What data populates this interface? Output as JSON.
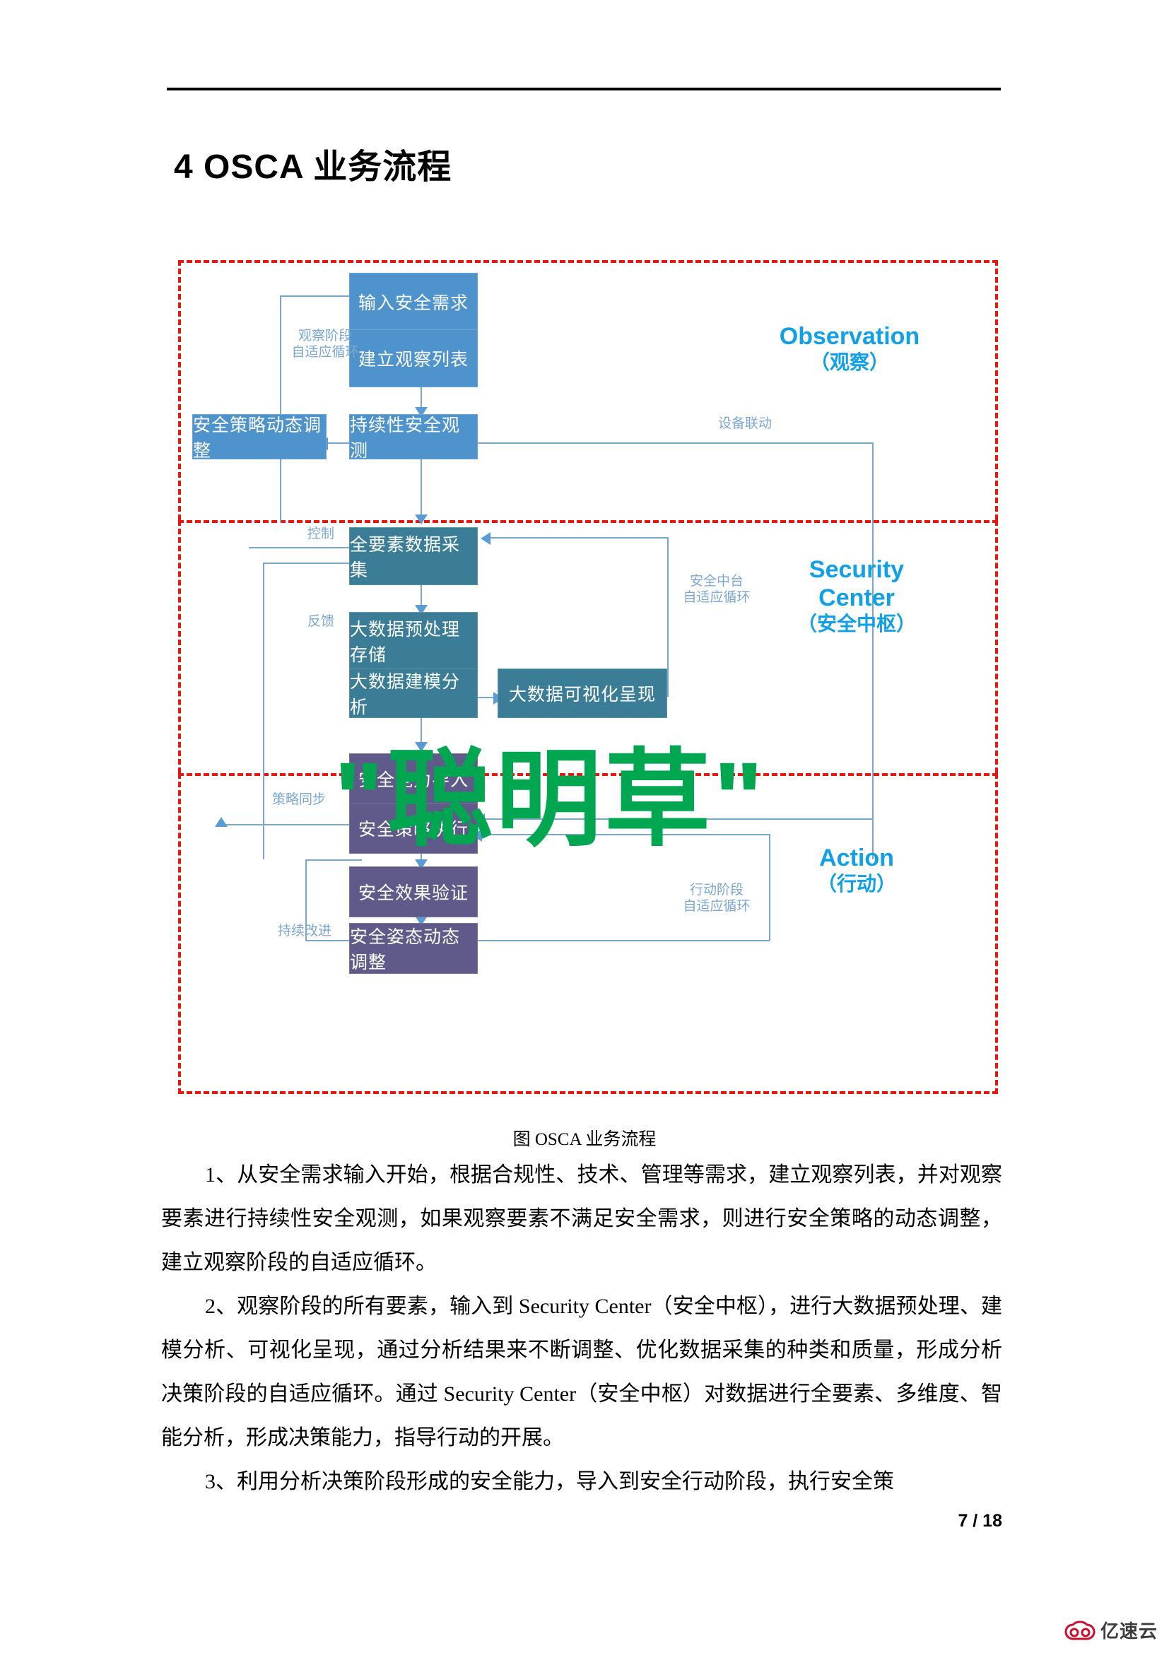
{
  "document": {
    "title": "4 OSCA 业务流程",
    "page_number": "7 / 18",
    "figure_caption": "图  OSCA 业务流程"
  },
  "figure": {
    "watermark": "\"聪明草\"",
    "zones": [
      {
        "id": "observation",
        "en": "Observation",
        "cn": "（观察）",
        "color": "#11a0e8"
      },
      {
        "id": "security-center",
        "en": "Security Center",
        "cn": "（安全中枢）",
        "color": "#11a0e8"
      },
      {
        "id": "action",
        "en": "Action",
        "cn": "（行动）",
        "color": "#11a0e8"
      }
    ],
    "zone_labels": {
      "observation_en": "Observation",
      "observation_cn": "（观察）",
      "security_en_line1": "Security",
      "security_en_line2": "Center",
      "security_cn": "（安全中枢）",
      "action_en": "Action",
      "action_cn": "（行动）"
    },
    "boxes": [
      {
        "id": "input-security-requirement",
        "label": "输入安全需求",
        "zone": "observation",
        "fill": "#4f93cd"
      },
      {
        "id": "build-observation-list",
        "label": "建立观察列表",
        "zone": "observation",
        "fill": "#4f93cd"
      },
      {
        "id": "continuous-security-observation",
        "label": "持续性安全观测",
        "zone": "observation",
        "fill": "#4f93cd"
      },
      {
        "id": "security-policy-dynamic-adjustment",
        "label": "安全策略动态调整",
        "zone": "observation",
        "fill": "#4f93cd"
      },
      {
        "id": "all-element-data-collection",
        "label": "全要素数据采集",
        "zone": "security-center",
        "fill": "#3b7d96"
      },
      {
        "id": "bigdata-preprocess-storage",
        "label": "大数据预处理存储",
        "zone": "security-center",
        "fill": "#3b7d96"
      },
      {
        "id": "bigdata-modeling-analysis",
        "label": "大数据建模分析",
        "zone": "security-center",
        "fill": "#3b7d96"
      },
      {
        "id": "bigdata-visualization",
        "label": "大数据可视化呈现",
        "zone": "security-center",
        "fill": "#3b7d96"
      },
      {
        "id": "security-capability-import",
        "label": "安全能力导入",
        "zone": "action",
        "fill": "#605a8a"
      },
      {
        "id": "security-policy-execution",
        "label": "安全策略执行",
        "zone": "action",
        "fill": "#605a8a"
      },
      {
        "id": "security-effect-validation",
        "label": "安全效果验证",
        "zone": "action",
        "fill": "#605a8a"
      },
      {
        "id": "security-posture-dynamic-adjustment",
        "label": "安全姿态动态调整",
        "zone": "action",
        "fill": "#605a8a"
      }
    ],
    "annotations": [
      {
        "id": "observation-adaptive-loop",
        "line1": "观察阶段",
        "line2": "自适应循环"
      },
      {
        "id": "device-linkage",
        "line1": "设备联动",
        "line2": ""
      },
      {
        "id": "control",
        "line1": "控制",
        "line2": ""
      },
      {
        "id": "feedback",
        "line1": "反馈",
        "line2": ""
      },
      {
        "id": "security-midplatform-adaptive-loop",
        "line1": "安全中台",
        "line2": "自适应循环"
      },
      {
        "id": "policy-sync",
        "line1": "策略同步",
        "line2": ""
      },
      {
        "id": "action-adaptive-loop",
        "line1": "行动阶段",
        "line2": "自适应循环"
      },
      {
        "id": "continuous-improvement",
        "line1": "持续改进",
        "line2": ""
      }
    ]
  },
  "body": {
    "paragraphs": [
      "1、从安全需求输入开始，根据合规性、技术、管理等需求，建立观察列表，并对观察要素进行持续性安全观测，如果观察要素不满足安全需求，则进行安全策略的动态调整，建立观察阶段的自适应循环。",
      "2、观察阶段的所有要素，输入到 Security Center（安全中枢），进行大数据预处理、建模分析、可视化呈现，通过分析结果来不断调整、优化数据采集的种类和质量，形成分析决策阶段的自适应循环。通过 Security Center（安全中枢）对数据进行全要素、多维度、智能分析，形成决策能力，指导行动的开展。",
      "3、利用分析决策阶段形成的安全能力，导入到安全行动阶段，执行安全策"
    ]
  },
  "footer": {
    "brand": "亿速云"
  }
}
